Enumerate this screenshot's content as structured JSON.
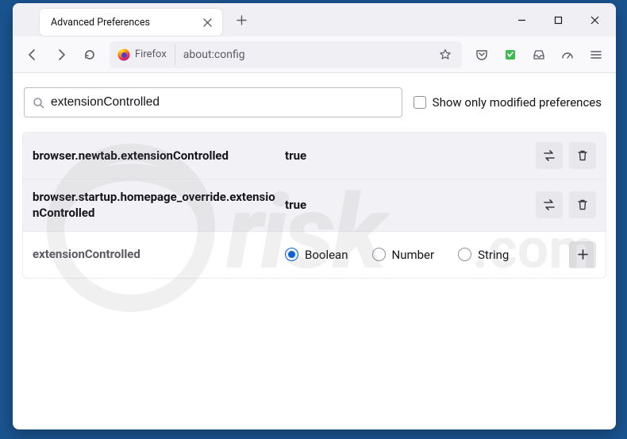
{
  "tab": {
    "title": "Advanced Preferences"
  },
  "urlbar": {
    "identity": "Firefox",
    "url": "about:config"
  },
  "search": {
    "value": "extensionControlled",
    "checkbox_label": "Show only modified preferences"
  },
  "prefs": [
    {
      "name": "browser.newtab.extensionControlled",
      "value": "true"
    },
    {
      "name": "browser.startup.homepage_override.extensionControlled",
      "value": "true"
    }
  ],
  "newPref": {
    "name": "extensionControlled",
    "types": [
      "Boolean",
      "Number",
      "String"
    ],
    "selected": "Boolean"
  }
}
